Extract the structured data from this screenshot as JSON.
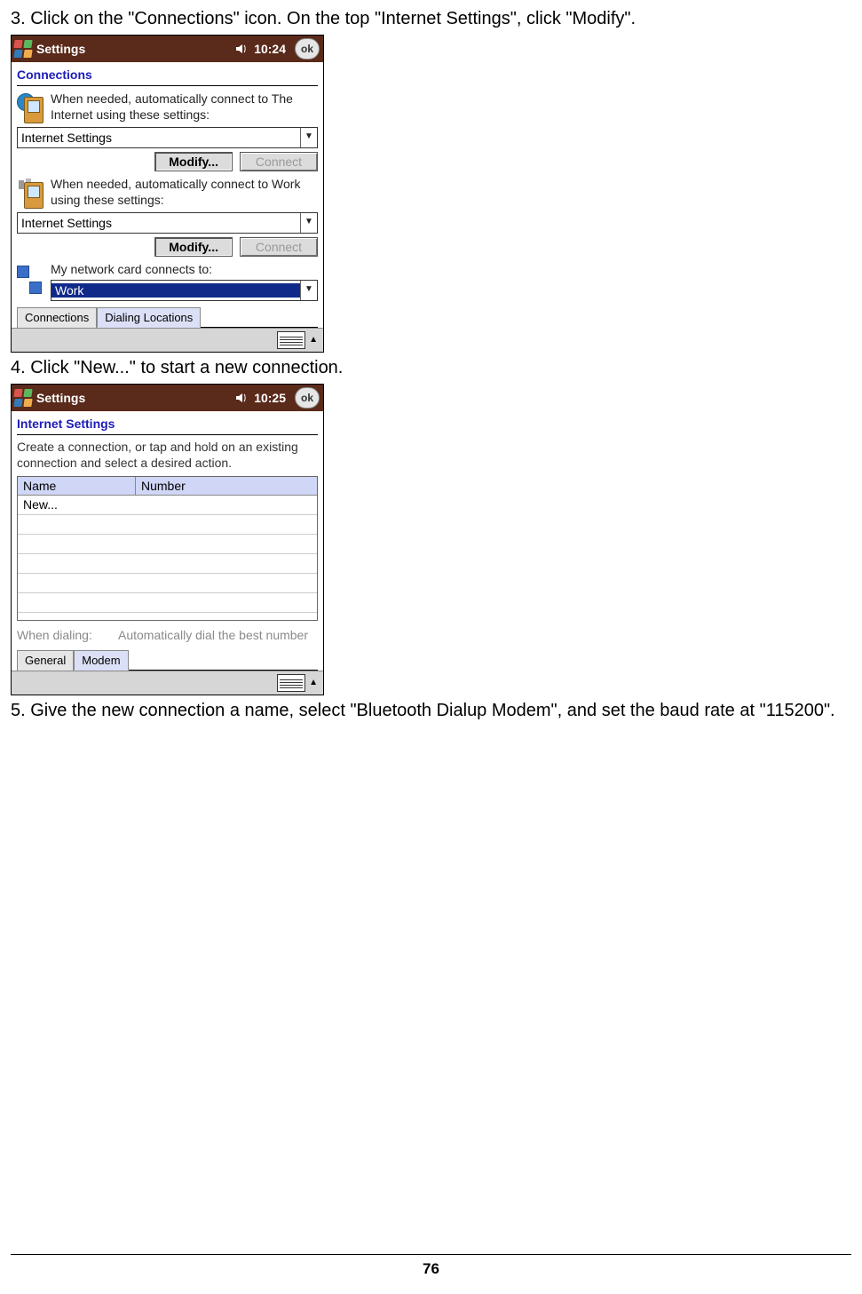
{
  "step3": "3. Click on the \"Connections\" icon. On the top \"Internet Settings\", click \"Modify\".",
  "step4": "4. Click \"New...\" to start a new connection.",
  "step5": "5. Give the new connection a name, select \"Bluetooth Dialup Modem\", and set the baud rate at \"115200\".",
  "page_number": "76",
  "pda1": {
    "title": "Settings",
    "time": "10:24",
    "ok": "ok",
    "section": "Connections",
    "internet_text": "When needed, automatically connect to The Internet using these settings:",
    "internet_dd": "Internet Settings",
    "work_text": "When needed, automatically connect to Work using these settings:",
    "work_dd": "Internet Settings",
    "card_text": "My network card connects to:",
    "card_dd": "Work",
    "modify": "Modify...",
    "connect": "Connect",
    "tab1": "Connections",
    "tab2": "Dialing Locations"
  },
  "pda2": {
    "title": "Settings",
    "time": "10:25",
    "ok": "ok",
    "section": "Internet Settings",
    "helper": "Create a connection, or tap and hold on an existing connection and select a desired action.",
    "col_name": "Name",
    "col_number": "Number",
    "row1": "New...",
    "dial_label": "When dialing:",
    "dial_value": "Automatically dial the best number",
    "tab1": "General",
    "tab2": "Modem"
  }
}
